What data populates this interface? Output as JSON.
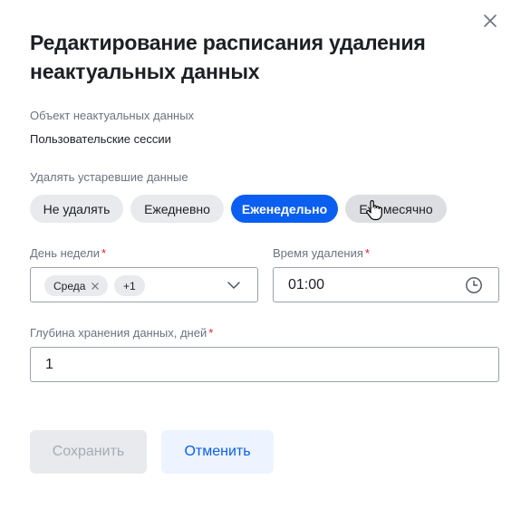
{
  "dialog": {
    "title": "Редактирование расписания удаления неактуальных данных",
    "close_icon": "close-icon"
  },
  "object": {
    "label": "Объект неактуальных данных",
    "value": "Пользовательские сессии"
  },
  "delete_mode": {
    "label": "Удалять устаревшие данные",
    "options": [
      "Не удалять",
      "Ежедневно",
      "Еженедельно",
      "Ежемесячно"
    ],
    "selected": "Еженедельно",
    "active_color": "#0a5ef0"
  },
  "weekday": {
    "label": "День недели",
    "required_mark": "*",
    "selected_tag": "Среда",
    "more_tag": "+1",
    "dropdown_icon": "chevron-down-icon"
  },
  "delete_time": {
    "label": "Время удаления",
    "required_mark": "*",
    "value": "01:00",
    "icon": "clock-icon"
  },
  "retention": {
    "label": "Глубина хранения данных, дней",
    "required_mark": "*",
    "value": "1"
  },
  "actions": {
    "save_label": "Сохранить",
    "cancel_label": "Отменить"
  }
}
